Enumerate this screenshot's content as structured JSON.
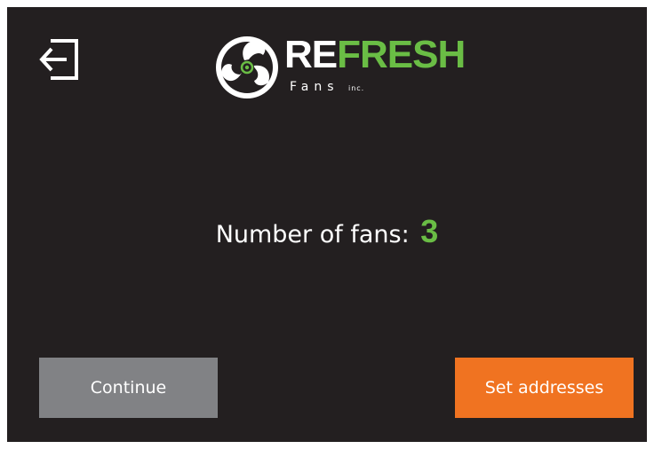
{
  "header": {
    "exit_icon": "exit-icon",
    "logo": {
      "brand_part1": "RE",
      "brand_part2": "FRESH",
      "subtitle": "Fans",
      "suffix": "inc.",
      "icon": "fan-logo-icon"
    }
  },
  "main": {
    "fan_count_label": "Number of fans:",
    "fan_count_value": "3"
  },
  "footer": {
    "continue_label": "Continue",
    "set_addresses_label": "Set addresses"
  },
  "colors": {
    "background": "#231f20",
    "accent_green": "#6abd45",
    "continue_button": "#818285",
    "set_addresses_button": "#f07321",
    "text": "#ffffff"
  }
}
